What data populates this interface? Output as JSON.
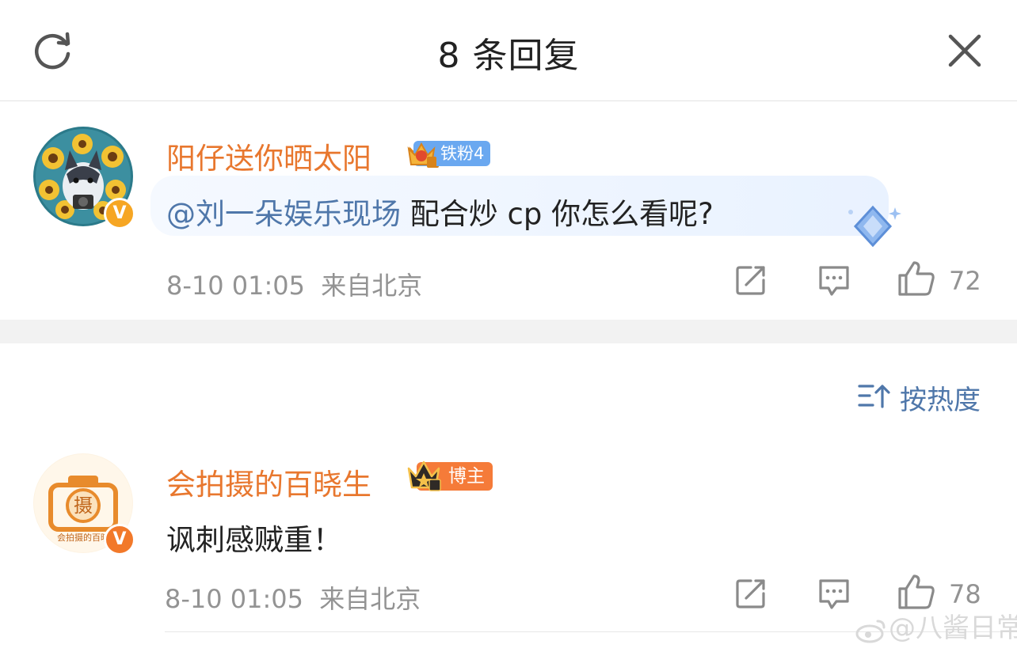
{
  "header": {
    "title": "8 条回复",
    "refresh_icon": "refresh-icon",
    "close_icon": "close-icon"
  },
  "sort": {
    "label": "按热度",
    "icon": "sort-icon"
  },
  "comments": [
    {
      "username": "阳仔送你晒太阳",
      "badge": "铁粉4",
      "badge_level": "3",
      "verified": "V",
      "mention": "@刘一朵娱乐现场",
      "text": " 配合炒 cp 你怎么看呢?",
      "date": "8-10 01:05",
      "location": "来自北京",
      "likes": "72"
    },
    {
      "username": "会拍摄的百晓生",
      "badge": "博主",
      "badge_level": "II",
      "verified": "V",
      "avatar_text": "摄",
      "avatar_caption": "会拍摄的百晓",
      "text": "讽刺感贼重！",
      "date": "8-10 01:05",
      "location": "来自北京",
      "likes": "78"
    }
  ],
  "watermark": "@八酱日常",
  "colors": {
    "username": "#e8772e",
    "mention": "#4f77aa",
    "meta": "#939393",
    "fan_badge": "#6aa8f0",
    "blogger_badge": "#f57b39",
    "verified": "#f6a623"
  }
}
